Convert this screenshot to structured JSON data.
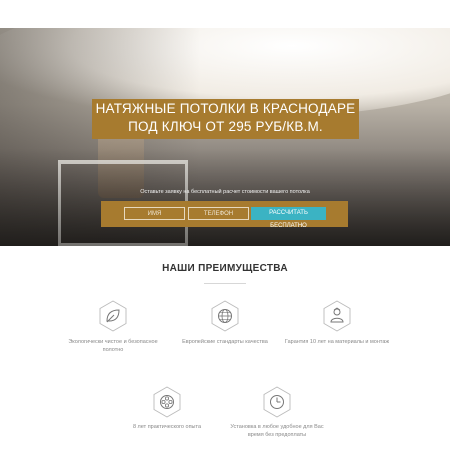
{
  "hero": {
    "title_line1": "НАТЯЖНЫЕ ПОТОЛКИ В КРАСНОДАРЕ",
    "title_line2": "ПОД КЛЮЧ ОТ 295 РУБ/КВ.М.",
    "note": "Оставьте заявку на бесплатный расчет стоимости вашего потолка",
    "form": {
      "name_placeholder": "ИМЯ",
      "phone_placeholder": "ТЕЛЕФОН",
      "cta_label": "РАССЧИТАТЬ БЕСПЛАТНО"
    },
    "colors": {
      "accent": "#a77b2f",
      "cta": "#3bb3c3"
    }
  },
  "advantages": {
    "title": "НАШИ ПРЕИМУЩЕСТВА",
    "items": [
      {
        "icon": "leaf-icon",
        "text_line1": "Экологически чистое и безопасное",
        "text_line2": "полотно"
      },
      {
        "icon": "globe-icon",
        "text_line1": "Европейские стандарты качества",
        "text_line2": ""
      },
      {
        "icon": "worker-icon",
        "text_line1": "Гарантия 10 лет на материалы и монтаж",
        "text_line2": ""
      },
      {
        "icon": "film-reel-icon",
        "text_line1": "8 лет практического опыта",
        "text_line2": ""
      },
      {
        "icon": "clock-icon",
        "text_line1": "Установка в любое удобное для Вас",
        "text_line2": "время без предоплаты"
      }
    ]
  }
}
